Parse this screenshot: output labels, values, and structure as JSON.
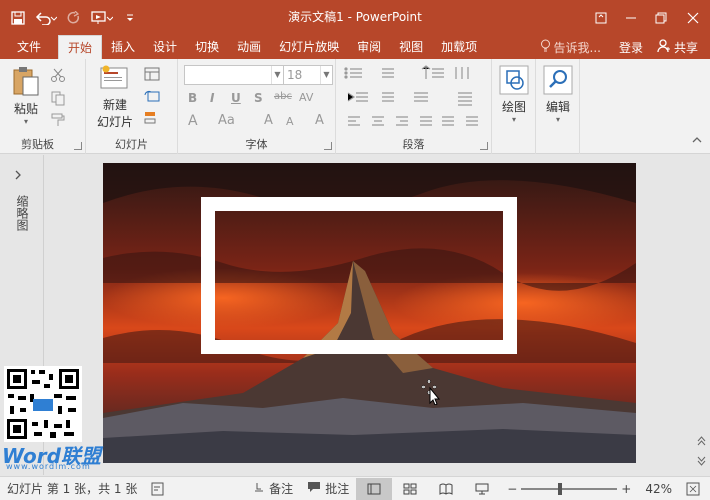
{
  "window": {
    "title": "演示文稿1 - PowerPoint",
    "qat_icons": [
      "save-icon",
      "undo-icon",
      "redo-icon",
      "present-from-start-icon",
      "customize-qat-icon"
    ],
    "controls": [
      "ribbon-display-icon",
      "minimize-icon",
      "restore-icon",
      "close-icon"
    ]
  },
  "tabs": [
    {
      "label": "文件"
    },
    {
      "label": "开始",
      "active": true
    },
    {
      "label": "插入"
    },
    {
      "label": "设计"
    },
    {
      "label": "切换"
    },
    {
      "label": "动画"
    },
    {
      "label": "幻灯片放映"
    },
    {
      "label": "审阅"
    },
    {
      "label": "视图"
    },
    {
      "label": "加载项"
    }
  ],
  "tell_me": "告诉我...",
  "sign_in": "登录",
  "share": "共享",
  "ribbon": {
    "clipboard": {
      "label": "剪贴板",
      "paste": "粘贴"
    },
    "slides": {
      "label": "幻灯片",
      "new_slide_1": "新建",
      "new_slide_2": "幻灯片"
    },
    "font": {
      "label": "字体",
      "font_name": "",
      "font_size": "18"
    },
    "paragraph": {
      "label": "段落"
    },
    "drawing": {
      "label": "",
      "button": "绘图"
    },
    "editing": {
      "label": "",
      "button": "编辑"
    }
  },
  "left_rail": {
    "label": "缩略图"
  },
  "watermark": {
    "brand": "Word联盟",
    "url": "www.wordlm.com"
  },
  "status": {
    "slide_info": "幻灯片 第 1 张，共 1 张",
    "notes": "备注",
    "comments": "批注",
    "zoom": "42%",
    "zoom_level": 0.42
  },
  "colors": {
    "accent": "#b7472a",
    "ribbon_bg": "#f2f2f2",
    "status_bg": "#f2f2f2"
  }
}
